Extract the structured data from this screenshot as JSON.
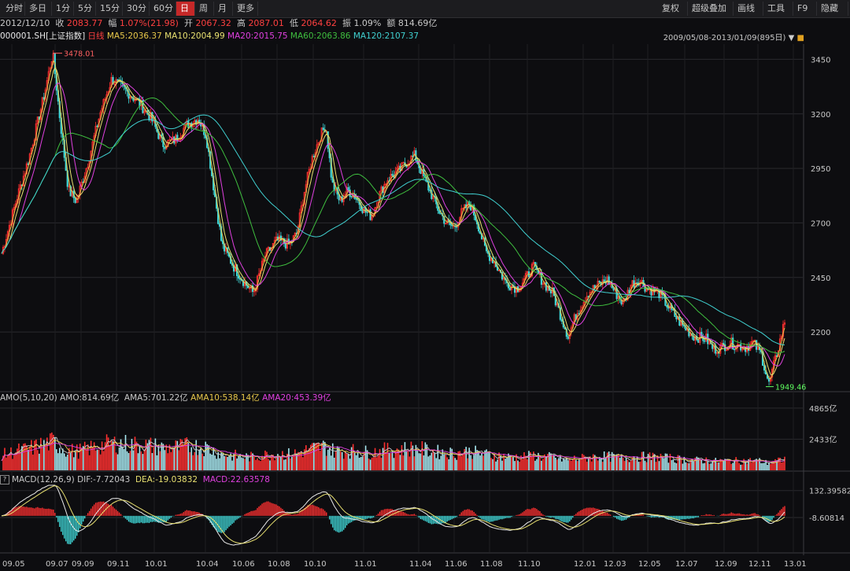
{
  "toolbar": {
    "left": [
      "分时",
      "多日",
      "1分",
      "5分",
      "15分",
      "30分",
      "60分",
      "日",
      "周",
      "月",
      "更多"
    ],
    "active": "日",
    "right": [
      "复权",
      "超级叠加",
      "画线",
      "工具",
      "F9",
      "隐藏"
    ]
  },
  "quote": {
    "date": "2012/12/10",
    "close_label": "收",
    "close": "2083.77",
    "change_label": "幅",
    "change": "1.07%(21.98)",
    "open_label": "开",
    "open": "2067.32",
    "high_label": "高",
    "high": "2087.01",
    "low_label": "低",
    "low": "2064.62",
    "amp_label": "振",
    "amp": "1.09%",
    "amount_label": "额",
    "amount": "814.69亿"
  },
  "ma_line": {
    "code": "000001.SH",
    "name": "[上证指数]",
    "period": "日线",
    "ma5": "MA5:2036.37",
    "ma10": "MA10:2004.99",
    "ma20": "MA20:2015.75",
    "ma60": "MA60:2063.86",
    "ma120": "MA120:2107.37",
    "range": "2009/05/08-2013/01/09(895日)"
  },
  "volume_line": {
    "label": "AMO(5,10,20)",
    "amo": "AMO:814.69亿",
    "amo5": "AMA5:701.22亿",
    "amo10": "AMA10:538.14亿",
    "amo20": "AMA20:453.39亿"
  },
  "macd_line": {
    "label": "MACD(12,26,9)",
    "dif": "DIF:-7.72043",
    "dea": "DEA:-19.03832",
    "macd": "MACD:22.63578"
  },
  "colors": {
    "up": "#ff3030",
    "down": "#40d8d8",
    "ma5": "#e8c84a",
    "ma10": "#e8e070",
    "ma20": "#e040e0",
    "ma60": "#3fbf3f",
    "ma120": "#40d0d0",
    "grid": "#2a2a2e"
  },
  "chart_data": {
    "type": "line",
    "price_axis": {
      "ticks": [
        "3450",
        "3200",
        "2950",
        "2700",
        "2450",
        "2200"
      ],
      "ylim": [
        1930,
        3520
      ]
    },
    "volume_axis": {
      "ticks": [
        "4865亿",
        "2433亿"
      ],
      "ylim": [
        0,
        5100
      ]
    },
    "macd_axis": {
      "ticks": [
        "132.39582",
        "-8.60814"
      ],
      "ylim": [
        -190,
        160
      ]
    },
    "x_ticks": [
      "09.05",
      "09.07",
      "09.09",
      "09.11",
      "10.01",
      "10.04",
      "10.06",
      "10.08",
      "10.10",
      "11.01",
      "11.04",
      "11.06",
      "11.08",
      "11.10",
      "12.01",
      "12.03",
      "12.05",
      "12.07",
      "12.09",
      "12.11",
      "13.01"
    ],
    "annotations": {
      "high": "3478.01",
      "low": "1949.46"
    },
    "close_keypoints": [
      [
        0,
        2560
      ],
      [
        20,
        2820
      ],
      [
        35,
        3000
      ],
      [
        55,
        3300
      ],
      [
        65,
        3478
      ],
      [
        75,
        3150
      ],
      [
        85,
        2850
      ],
      [
        95,
        2800
      ],
      [
        110,
        2980
      ],
      [
        125,
        3200
      ],
      [
        140,
        3360
      ],
      [
        160,
        3300
      ],
      [
        175,
        3250
      ],
      [
        190,
        3180
      ],
      [
        205,
        3060
      ],
      [
        220,
        3080
      ],
      [
        235,
        3150
      ],
      [
        250,
        3180
      ],
      [
        260,
        3100
      ],
      [
        270,
        2850
      ],
      [
        280,
        2600
      ],
      [
        295,
        2500
      ],
      [
        310,
        2420
      ],
      [
        320,
        2380
      ],
      [
        335,
        2550
      ],
      [
        350,
        2620
      ],
      [
        365,
        2600
      ],
      [
        375,
        2650
      ],
      [
        385,
        2850
      ],
      [
        395,
        3000
      ],
      [
        405,
        3100
      ],
      [
        412,
        3150
      ],
      [
        420,
        2880
      ],
      [
        430,
        2800
      ],
      [
        440,
        2850
      ],
      [
        450,
        2820
      ],
      [
        460,
        2760
      ],
      [
        470,
        2730
      ],
      [
        480,
        2830
      ],
      [
        490,
        2900
      ],
      [
        505,
        2940
      ],
      [
        515,
        2980
      ],
      [
        525,
        3010
      ],
      [
        535,
        2920
      ],
      [
        545,
        2840
      ],
      [
        555,
        2760
      ],
      [
        565,
        2700
      ],
      [
        575,
        2680
      ],
      [
        585,
        2750
      ],
      [
        595,
        2790
      ],
      [
        605,
        2700
      ],
      [
        615,
        2570
      ],
      [
        625,
        2530
      ],
      [
        640,
        2430
      ],
      [
        655,
        2400
      ],
      [
        665,
        2440
      ],
      [
        675,
        2500
      ],
      [
        690,
        2420
      ],
      [
        700,
        2380
      ],
      [
        710,
        2280
      ],
      [
        720,
        2180
      ],
      [
        730,
        2280
      ],
      [
        745,
        2380
      ],
      [
        760,
        2420
      ],
      [
        770,
        2440
      ],
      [
        780,
        2380
      ],
      [
        790,
        2330
      ],
      [
        800,
        2420
      ],
      [
        810,
        2440
      ],
      [
        820,
        2400
      ],
      [
        835,
        2380
      ],
      [
        850,
        2300
      ],
      [
        865,
        2230
      ],
      [
        880,
        2180
      ],
      [
        895,
        2170
      ],
      [
        905,
        2120
      ],
      [
        915,
        2130
      ],
      [
        925,
        2150
      ],
      [
        935,
        2140
      ],
      [
        945,
        2130
      ],
      [
        955,
        2150
      ],
      [
        965,
        2100
      ],
      [
        975,
        1960
      ],
      [
        985,
        2100
      ],
      [
        995,
        2250
      ]
    ]
  }
}
